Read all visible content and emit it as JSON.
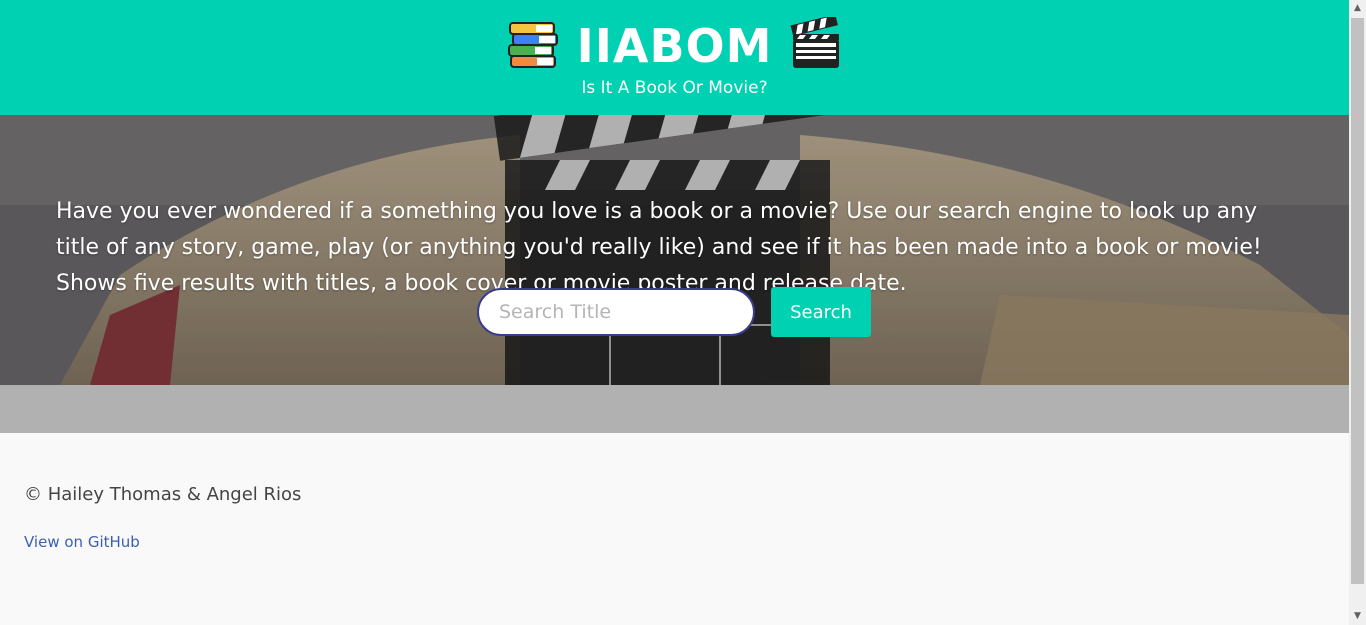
{
  "header": {
    "title": "IIABOM",
    "subtitle": "Is It A Book Or Movie?",
    "left_icon": "books-icon",
    "right_icon": "clapper-board-icon"
  },
  "hero": {
    "description": "Have you ever wondered if a something you love is a book or a movie? Use our search engine to look up any title of any story, game, play (or anything you'd really like) and see if it has been made into a book or movie! Shows five results with titles, a book cover or movie poster and release date.",
    "search_placeholder": "Search Title",
    "search_value": "",
    "search_button": "Search"
  },
  "footer": {
    "copyright": "© Hailey Thomas & Angel Rios",
    "github_link": "View on GitHub"
  },
  "colors": {
    "accent": "#00d1b2",
    "results_band": "#b1b1b1",
    "link": "#3d5fb0"
  }
}
